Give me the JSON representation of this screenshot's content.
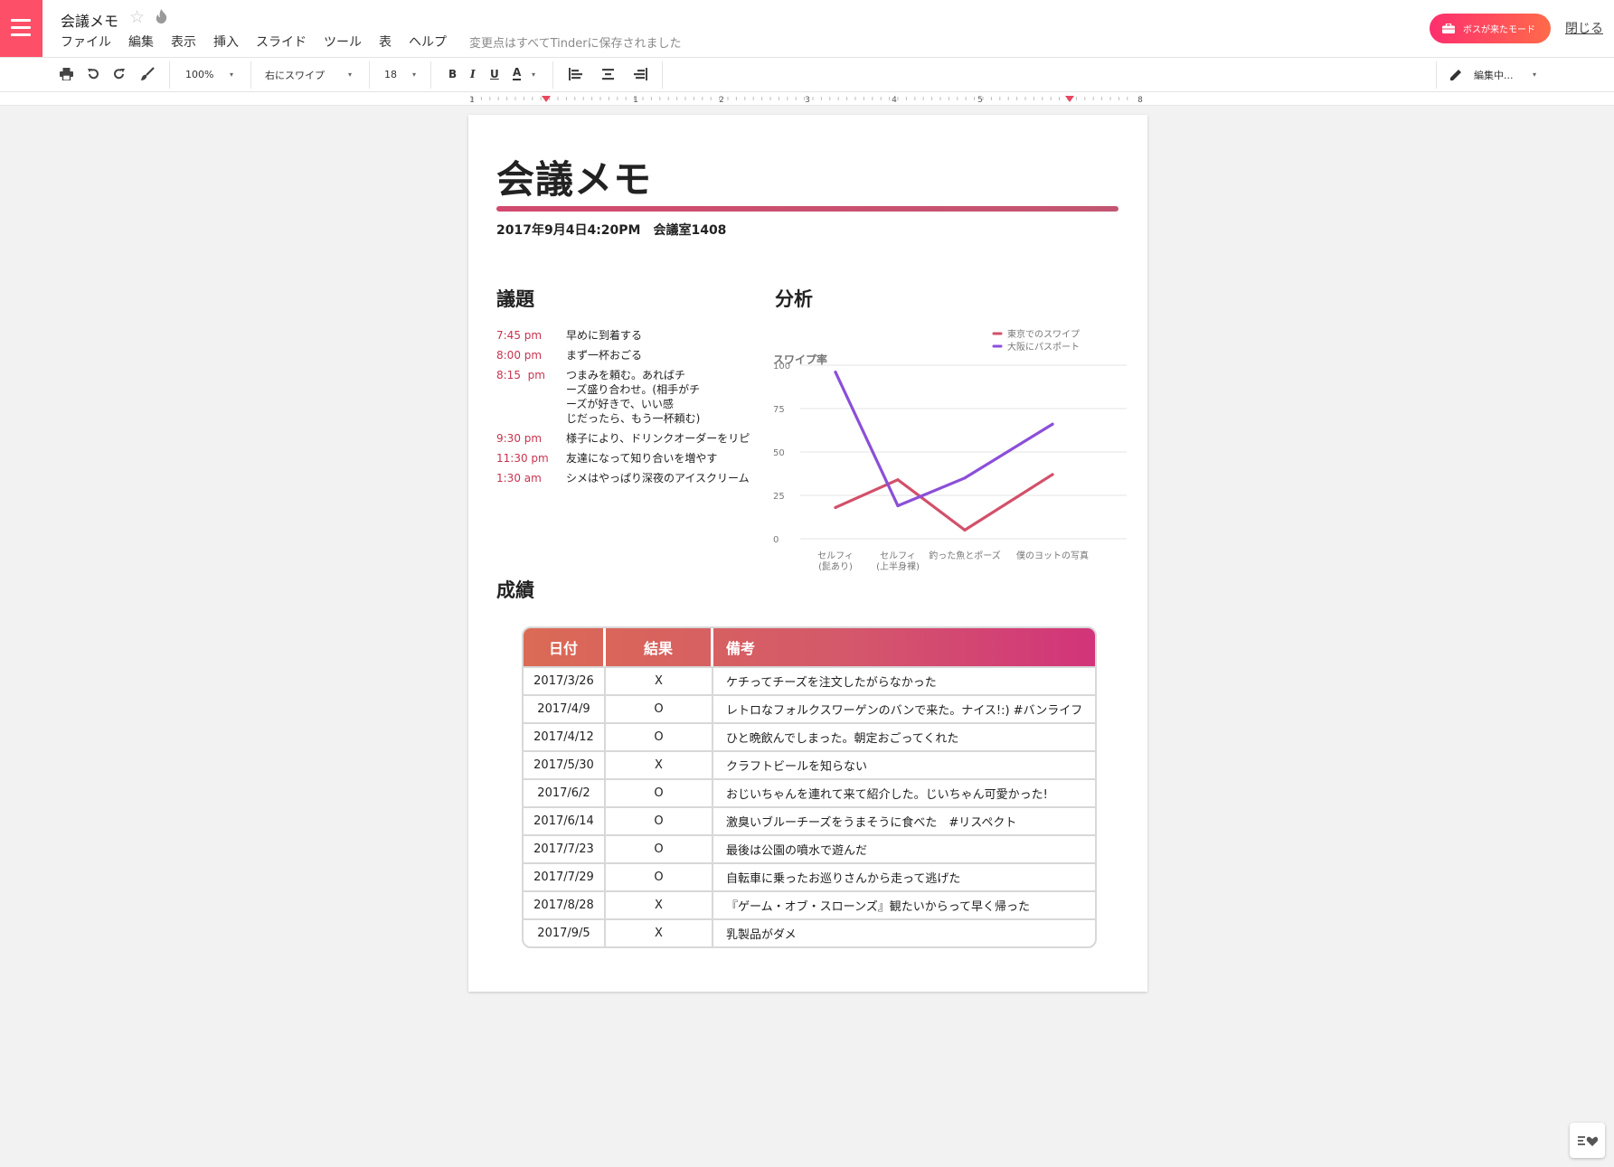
{
  "app": {
    "doc_title": "会議メモ",
    "menu": [
      "ファイル",
      "編集",
      "表示",
      "挿入",
      "スライド",
      "ツール",
      "表",
      "ヘルプ"
    ],
    "save_status": "変更点はすべてTinderに保存されました",
    "boss_button": "ボスが来たモード",
    "close_link": "閉じる",
    "accent_color": "#fd5068"
  },
  "toolbar": {
    "zoom": "100%",
    "style": "右にスワイプ",
    "font_size": "18",
    "bold": "B",
    "italic": "I",
    "underline": "U",
    "text_color": "A",
    "mode": "編集中..."
  },
  "ruler": {
    "labels": [
      "1",
      "1",
      "2",
      "3",
      "4",
      "5",
      "8"
    ]
  },
  "document": {
    "heading": "会議メモ",
    "meeting_info": "2017年9月4日4:20PM　会議室1408",
    "agenda_title": "議題",
    "analysis_title": "分析",
    "results_title": "成績",
    "agenda": [
      {
        "time": "7:45 pm",
        "text": "早めに到着する"
      },
      {
        "time": "8:00 pm",
        "text": "まず一杯おごる"
      },
      {
        "time": "8:15  pm",
        "text": "つまみを頼む。あればチ\nーズ盛り合わせ。(相手がチ\nーズが好きで、いい感\nじだったら、もう一杯頼む)"
      },
      {
        "time": "9:30 pm",
        "text": "様子により、ドリンクオーダーをリピ"
      },
      {
        "time": "11:30 pm",
        "text": "友達になって知り合いを増やす"
      },
      {
        "time": "1:30 am",
        "text": "シメはやっぱり深夜のアイスクリーム"
      }
    ],
    "table": {
      "headers": [
        "日付",
        "結果",
        "備考"
      ],
      "rows": [
        [
          "2017/3/26",
          "X",
          "ケチってチーズを注文したがらなかった"
        ],
        [
          "2017/4/9",
          "O",
          "レトロなフォルクスワーゲンのバンで来た。ナイス!:) #バンライフ"
        ],
        [
          "2017/4/12",
          "O",
          "ひと晩飲んでしまった。朝定おごってくれた"
        ],
        [
          "2017/5/30",
          "X",
          "クラフトビールを知らない"
        ],
        [
          "2017/6/2",
          "O",
          "おじいちゃんを連れて来て紹介した。じいちゃん可愛かった!"
        ],
        [
          "2017/6/14",
          "O",
          "激臭いブルーチーズをうまそうに食べた　#リスペクト"
        ],
        [
          "2017/7/23",
          "O",
          "最後は公園の噴水で遊んだ"
        ],
        [
          "2017/7/29",
          "O",
          "自転車に乗ったお巡りさんから走って逃げた"
        ],
        [
          "2017/8/28",
          "X",
          "『ゲーム・オブ・スローンズ』観たいからって早く帰った"
        ],
        [
          "2017/9/5",
          "X",
          "乳製品がダメ"
        ]
      ]
    }
  },
  "chart_data": {
    "type": "line",
    "title": "スワイプ率",
    "categories": [
      "セルフィ\n(髭あり)",
      "セルフィ\n(上半身裸)",
      "釣った魚とポーズ",
      "僕のヨットの写真"
    ],
    "ylim": [
      0,
      100
    ],
    "yticks": [
      0,
      25,
      50,
      75,
      100
    ],
    "grid": true,
    "legend_position": "top-right",
    "series": [
      {
        "name": "東京でのスワイプ",
        "color": "#d2506a",
        "values": [
          18,
          34,
          5,
          37
        ]
      },
      {
        "name": "大阪にパスポート",
        "color": "#8b4fd8",
        "values": [
          96,
          19,
          35,
          66
        ]
      }
    ]
  }
}
